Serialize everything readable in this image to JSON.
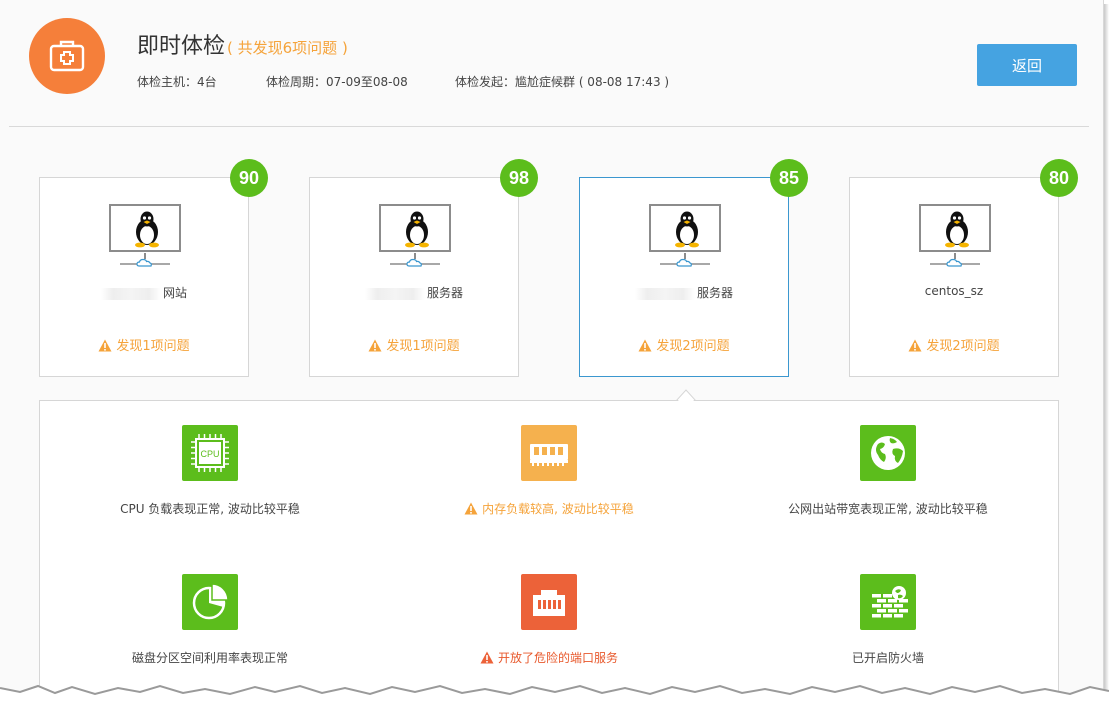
{
  "header": {
    "title": "即时体检",
    "subtitle": "( 共发现6项问题 )",
    "meta": {
      "hosts": "体检主机：4台",
      "period": "体检周期：07-09至08-08",
      "initiator": "体检发起：尴尬症候群 ( 08-08 17:43 )"
    },
    "back_label": "返回"
  },
  "hosts": [
    {
      "score": "90",
      "name": "网站",
      "issues": "发现1项问题",
      "active": false
    },
    {
      "score": "98",
      "name": "服务器",
      "issues": "发现1项问题",
      "active": false
    },
    {
      "score": "85",
      "name": "服务器",
      "issues": "发现2项问题",
      "active": true
    },
    {
      "score": "80",
      "name": "centos_sz",
      "issues": "发现2项问题",
      "active": false
    }
  ],
  "checks": [
    {
      "icon": "cpu-icon",
      "icon_text": "CPU",
      "label": "CPU 负载表现正常, 波动比较平稳",
      "status": "ok"
    },
    {
      "icon": "memory-icon",
      "label": "内存负载较高, 波动比较平稳",
      "status": "warning"
    },
    {
      "icon": "globe-icon",
      "label": "公网出站带宽表现正常, 波动比较平稳",
      "status": "ok"
    },
    {
      "icon": "pie-chart-icon",
      "label": "磁盘分区空间利用率表现正常",
      "status": "ok"
    },
    {
      "icon": "port-icon",
      "label": "开放了危险的端口服务",
      "status": "danger"
    },
    {
      "icon": "firewall-icon",
      "label": "已开启防火墙",
      "status": "ok"
    }
  ],
  "colors": {
    "accent_orange": "#f57f3a",
    "score_green": "#5cbd1c",
    "warning": "#f5a33a",
    "danger": "#ec6239",
    "button_blue": "#45a3e1",
    "active_border": "#3b97cf"
  }
}
